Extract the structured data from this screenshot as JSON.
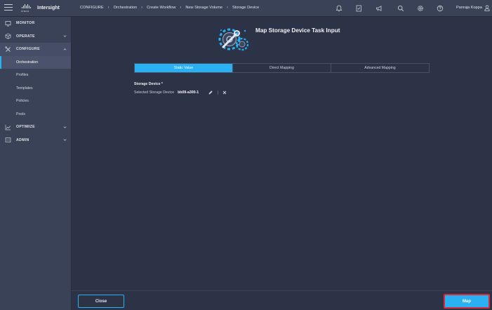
{
  "app": {
    "name": "Intersight",
    "logo_word": "cisco"
  },
  "breadcrumb": {
    "items": [
      "CONFIGURE",
      "Orchestration",
      "Create Workflow",
      "New Storage Volume",
      "Storage Device"
    ]
  },
  "topbar": {
    "icons": [
      "bell-icon",
      "checklist-icon",
      "megaphone-icon",
      "search-icon",
      "gear-icon",
      "help-icon"
    ],
    "user_name": "Panraja Koppa"
  },
  "sidebar": {
    "items": [
      {
        "label": "MONITOR",
        "icon": "monitor-icon"
      },
      {
        "label": "OPERATE",
        "icon": "cube-icon"
      },
      {
        "label": "CONFIGURE",
        "icon": "wrench-icon"
      },
      {
        "label": "OPTIMIZE",
        "icon": "trend-icon"
      },
      {
        "label": "ADMIN",
        "icon": "admin-icon"
      }
    ],
    "configure_sub": [
      "Orchestration",
      "Profiles",
      "Templates",
      "Policies",
      "Pools"
    ]
  },
  "main": {
    "title": "Map Storage Device Task Input",
    "tabs": [
      "Static Value",
      "Direct Mapping",
      "Advanced Mapping"
    ],
    "selected_tab": "Static Value",
    "field_label": "Storage Device *",
    "field_row_label": "Selected Storage Device",
    "field_row_value": "bb09-a300-1"
  },
  "footer": {
    "close_label": "Close",
    "map_label": "Map"
  },
  "colors": {
    "accent": "#29b1f4",
    "highlight_border": "#d92b3a",
    "background": "#2c3346",
    "sidebar": "#3a4257"
  }
}
